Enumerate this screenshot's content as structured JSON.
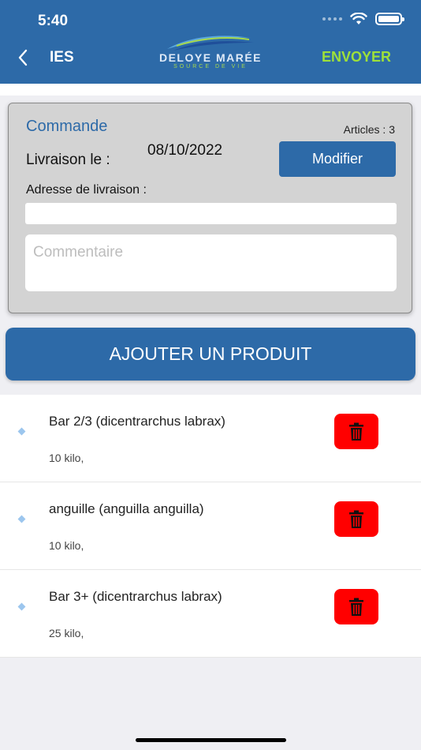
{
  "status_bar": {
    "time": "5:40"
  },
  "header": {
    "back_label": "IES",
    "logo_name": "DELOYE MARÉE",
    "logo_tagline": "SOURCE DE VIE",
    "send_label": "ENVOYER"
  },
  "order": {
    "title": "Commande",
    "articles": "Articles : 3",
    "delivery_label": "Livraison le :",
    "delivery_date": "08/10/2022",
    "modify_label": "Modifier",
    "address_label": "Adresse de livraison :",
    "address_value": "",
    "comment_placeholder": "Commentaire"
  },
  "add_product_label": "AJOUTER UN PRODUIT",
  "products": [
    {
      "name": "Bar 2/3 (dicentrarchus labrax)",
      "quantity": "10 kilo,"
    },
    {
      "name": "anguille (anguilla anguilla)",
      "quantity": "10 kilo,"
    },
    {
      "name": "Bar 3+ (dicentrarchus labrax)",
      "quantity": "25 kilo,"
    }
  ],
  "colors": {
    "primary": "#2d6aa8",
    "send_accent": "#9ee03a",
    "delete": "#ff0000",
    "card_bg": "#d3d3d3"
  }
}
